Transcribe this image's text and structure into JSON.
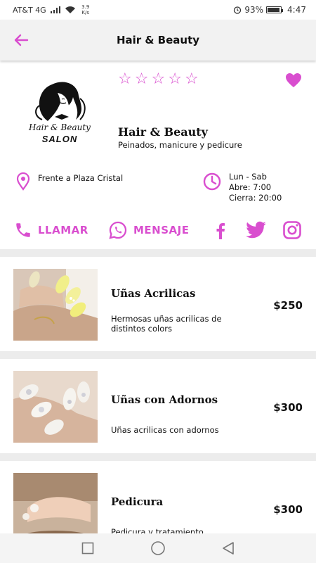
{
  "status_bar": {
    "carrier": "AT&T 4G",
    "speed": "3.9 K/s",
    "battery": "93%",
    "battery_level": 0.93,
    "time": "4:47"
  },
  "app_bar": {
    "title": "Hair & Beauty"
  },
  "business": {
    "logo_line1": "Hair & Beauty",
    "logo_line2": "SALON",
    "rating": 0,
    "rating_max": 5,
    "name": "Hair & Beauty",
    "description": "Peinados, manicure y pedicure",
    "address": "Frente a Plaza Cristal",
    "hours": [
      "Lun - Sab",
      "Abre: 7:00",
      "Cierra: 20:00"
    ]
  },
  "actions": {
    "call": "LLAMAR",
    "message": "MENSAJE"
  },
  "services": [
    {
      "title": "Uñas Acrilicas",
      "description": "Hermosas uñas acrilicas de distintos colors",
      "price": "$250"
    },
    {
      "title": "Uñas con Adornos",
      "description": "Uñas acrilicas con adornos",
      "price": "$300"
    },
    {
      "title": "Pedicura",
      "description": "Pedicura y tratamiento",
      "price": "$300"
    }
  ],
  "colors": {
    "accent": "#d94ecf",
    "divider": "#ececec",
    "app_bar": "#f2f2f2"
  },
  "icons": [
    "back-arrow-icon",
    "star-outline-icon",
    "heart-icon",
    "location-pin-icon",
    "clock-icon",
    "phone-icon",
    "whatsapp-icon",
    "facebook-icon",
    "twitter-icon",
    "instagram-icon",
    "square-nav-icon",
    "circle-nav-icon",
    "triangle-back-nav-icon"
  ]
}
